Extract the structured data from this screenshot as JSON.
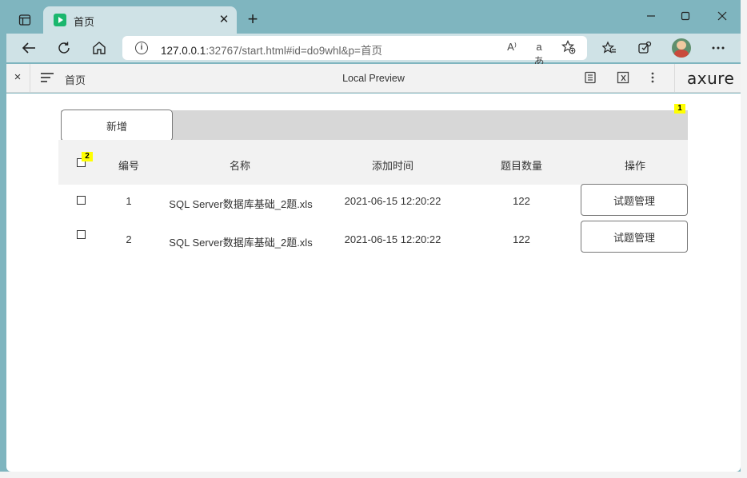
{
  "browser": {
    "tab_title": "首页",
    "url_host": "127.0.0.1",
    "url_rest": ":32767/start.html#id=do9whl&p=首页",
    "read_aloud_glyph": "A⁾",
    "translate_glyph": "aあ",
    "icons": [
      "tab-actions-icon",
      "close-icon",
      "plus-icon",
      "minimize-icon",
      "maximize-icon",
      "close-window-icon",
      "back-icon",
      "refresh-icon",
      "home-icon",
      "info-icon",
      "read-aloud-icon",
      "translate-icon",
      "add-favorite-icon",
      "favorites-icon",
      "extensions-icon",
      "avatar",
      "more-icon"
    ]
  },
  "axure": {
    "close_glyph": "×",
    "page_name": "首页",
    "preview_title": "Local Preview",
    "logo": "axure"
  },
  "page": {
    "add_label": "新增",
    "badge_1": "1",
    "badge_2": "2",
    "columns": [
      "编号",
      "名称",
      "添加时间",
      "题目数量",
      "操作"
    ],
    "rows": [
      {
        "id": "1",
        "name": "SQL Server数据库基础_2题.xls",
        "time": "2021-06-15 12:20:22",
        "count": "122",
        "action": "试题管理"
      },
      {
        "id": "2",
        "name": "SQL Server数据库基础_2题.xls",
        "time": "2021-06-15 12:20:22",
        "count": "122",
        "action": "试题管理"
      }
    ]
  },
  "colors": {
    "frame": "#7fb5bf",
    "toolbar": "#cfe2e6",
    "badge": "#ffff00",
    "favicon": "#1bb76e"
  }
}
